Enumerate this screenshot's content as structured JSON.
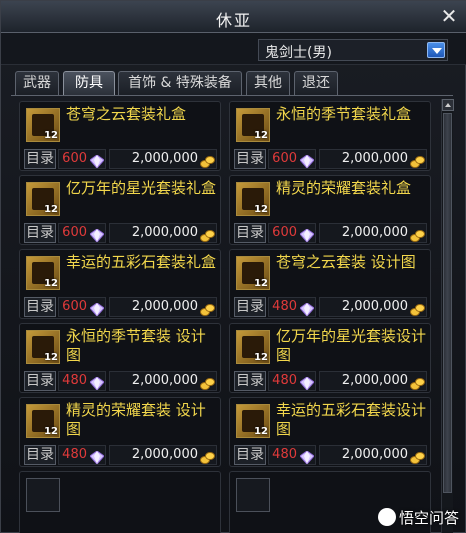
{
  "window": {
    "title": "休亚"
  },
  "class_select": {
    "value": "鬼剑士(男)"
  },
  "tabs": [
    {
      "label": "武器",
      "active": false
    },
    {
      "label": "防具",
      "active": true
    },
    {
      "label": "首饰 & 特殊装备",
      "active": false
    },
    {
      "label": "其他",
      "active": false
    },
    {
      "label": "退还",
      "active": false
    }
  ],
  "items": [
    {
      "name": "苍穹之云套装礼盒",
      "catalog": "目录",
      "price": "600",
      "gold": "2,000,000"
    },
    {
      "name": "永恒的季节套装礼盒",
      "catalog": "目录",
      "price": "600",
      "gold": "2,000,000"
    },
    {
      "name": "亿万年的星光套装礼盒",
      "catalog": "目录",
      "price": "600",
      "gold": "2,000,000"
    },
    {
      "name": "精灵的荣耀套装礼盒",
      "catalog": "目录",
      "price": "600",
      "gold": "2,000,000"
    },
    {
      "name": "幸运的五彩石套装礼盒",
      "catalog": "目录",
      "price": "600",
      "gold": "2,000,000"
    },
    {
      "name": "苍穹之云套装  设计图",
      "catalog": "目录",
      "price": "480",
      "gold": "2,000,000"
    },
    {
      "name": "永恒的季节套装  设计图",
      "catalog": "目录",
      "price": "480",
      "gold": "2,000,000"
    },
    {
      "name": "亿万年的星光套装设计图",
      "catalog": "目录",
      "price": "480",
      "gold": "2,000,000"
    },
    {
      "name": "精灵的荣耀套装  设计图",
      "catalog": "目录",
      "price": "480",
      "gold": "2,000,000"
    },
    {
      "name": "幸运的五彩石套装设计图",
      "catalog": "目录",
      "price": "480",
      "gold": "2,000,000"
    }
  ],
  "item_level": "12",
  "watermark": "悟空问答",
  "colors": {
    "item_name": "#f2d74c",
    "price": "#e03a3a",
    "active_select": "#1f58b8"
  },
  "icons": {
    "close": "close-icon",
    "dropdown": "chevron-down-icon",
    "gem": "gem-icon",
    "gold": "gold-coin-icon"
  }
}
